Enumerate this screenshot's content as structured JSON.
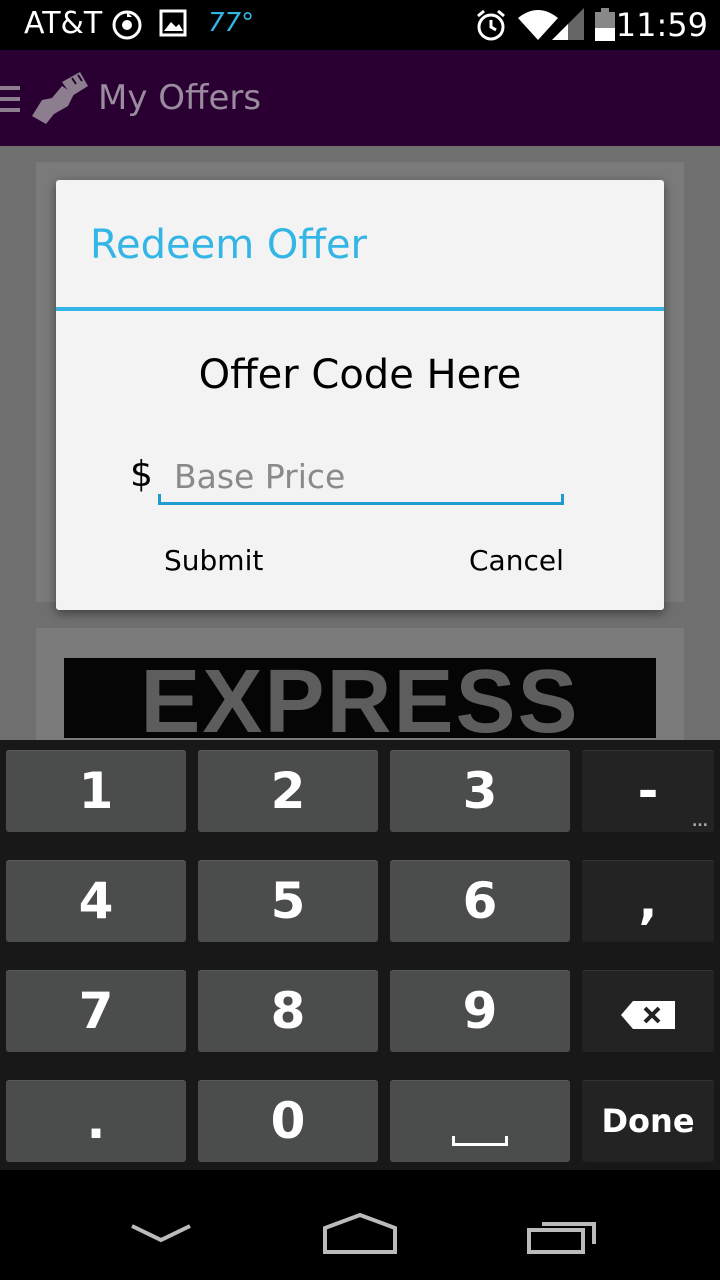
{
  "status_bar": {
    "carrier": "AT&T",
    "temperature": "77°",
    "time": "11:59",
    "icons": [
      "sync-icon",
      "image-icon",
      "alarm-icon",
      "wifi-icon",
      "signal-icon",
      "battery-icon"
    ]
  },
  "action_bar": {
    "title": "My Offers",
    "icons": [
      "menu-icon",
      "app-logo-icon"
    ],
    "background": "#2a0033"
  },
  "background_content": {
    "banner_text": "EXPRESS"
  },
  "dialog": {
    "title": "Redeem Offer",
    "offer_code": "Offer Code Here",
    "currency_symbol": "$",
    "price_input": {
      "value": "",
      "placeholder": "Base Price"
    },
    "submit_label": "Submit",
    "cancel_label": "Cancel",
    "accent_color": "#33b5e5"
  },
  "keyboard": {
    "row1": [
      "1",
      "2",
      "3",
      "-"
    ],
    "row2": [
      "4",
      "5",
      "6",
      ","
    ],
    "row3": [
      "7",
      "8",
      "9"
    ],
    "row4": [
      ".",
      "0"
    ],
    "dash_sub": "...",
    "done_label": "Done",
    "icons": [
      "backspace-icon",
      "space-icon"
    ]
  },
  "nav_bar": {
    "icons": [
      "back-icon",
      "home-icon",
      "recents-icon"
    ]
  }
}
